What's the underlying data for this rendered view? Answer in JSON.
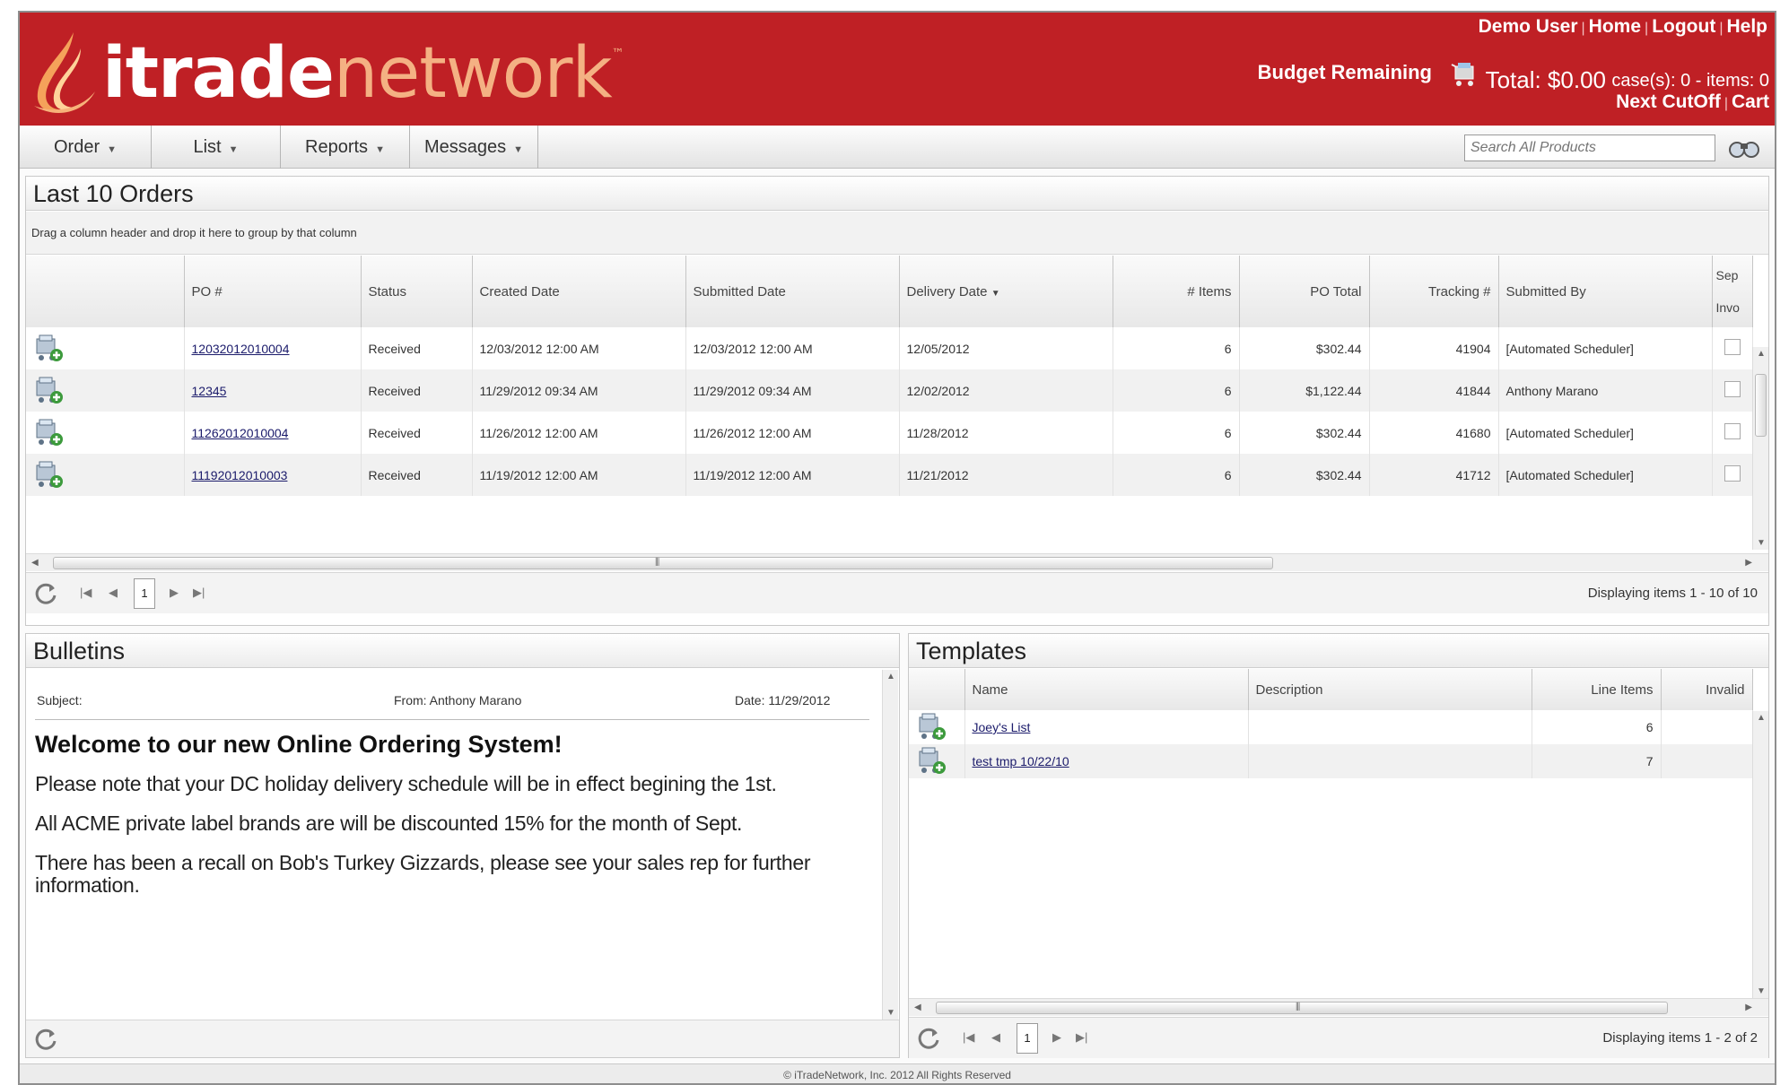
{
  "header": {
    "logo": {
      "word_main": "itrade",
      "word_accent": "network",
      "tm": "™"
    },
    "top_links": [
      "Demo User",
      "Home",
      "Logout",
      "Help"
    ],
    "budget_label": "Budget Remaining",
    "total": "Total: $0.00",
    "counts": "case(s): 0 - items: 0",
    "cart_links": [
      "Next CutOff",
      "Cart"
    ],
    "accent_color": "#bf2025"
  },
  "menu": {
    "items": [
      "Order",
      "List",
      "Reports",
      "Messages"
    ],
    "search_placeholder": "Search All Products",
    "search_icon": "binoculars-icon"
  },
  "orders": {
    "title": "Last 10 Orders",
    "group_hint": "Drag a column header and drop it here to group by that column",
    "columns": [
      "",
      "PO #",
      "Status",
      "Created Date",
      "Submitted Date",
      "Delivery Date",
      "# Items",
      "PO Total",
      "Tracking #",
      "Submitted By",
      "Sep Invo"
    ],
    "sort_indicator": "▼",
    "rows": [
      {
        "po": "12032012010004",
        "status": "Received",
        "created": "12/03/2012 12:00 AM",
        "submitted": "12/03/2012 12:00 AM",
        "delivery": "12/05/2012",
        "items": "6",
        "total": "$302.44",
        "tracking": "41904",
        "by": "[Automated Scheduler]"
      },
      {
        "po": "12345",
        "status": "Received",
        "created": "11/29/2012 09:34 AM",
        "submitted": "11/29/2012 09:34 AM",
        "delivery": "12/02/2012",
        "items": "6",
        "total": "$1,122.44",
        "tracking": "41844",
        "by": "Anthony Marano"
      },
      {
        "po": "11262012010004",
        "status": "Received",
        "created": "11/26/2012 12:00 AM",
        "submitted": "11/26/2012 12:00 AM",
        "delivery": "11/28/2012",
        "items": "6",
        "total": "$302.44",
        "tracking": "41680",
        "by": "[Automated Scheduler]"
      },
      {
        "po": "11192012010003",
        "status": "Received",
        "created": "11/19/2012 12:00 AM",
        "submitted": "11/19/2012 12:00 AM",
        "delivery": "11/21/2012",
        "items": "6",
        "total": "$302.44",
        "tracking": "41712",
        "by": "[Automated Scheduler]"
      }
    ],
    "pager": {
      "page": "1",
      "info": "Displaying items 1 - 10 of 10"
    }
  },
  "bulletins": {
    "title": "Bulletins",
    "subject_label": "Subject:",
    "from": "From: Anthony Marano",
    "date": "Date: 11/29/2012",
    "heading": "Welcome to our new Online Ordering System!",
    "paragraphs": [
      "Please note that your DC holiday delivery schedule will be in effect begining the 1st.",
      "All ACME private label brands are will be discounted 15% for the month of Sept.",
      "There has been a recall on Bob's Turkey Gizzards, please see your sales rep for further information."
    ]
  },
  "templates": {
    "title": "Templates",
    "columns": [
      "",
      "Name",
      "Description",
      "Line Items",
      "Invalid"
    ],
    "rows": [
      {
        "name": "Joey's List",
        "description": "",
        "line_items": "6",
        "invalid": ""
      },
      {
        "name": "test tmp 10/22/10",
        "description": "",
        "line_items": "7",
        "invalid": ""
      }
    ],
    "pager": {
      "page": "1",
      "info": "Displaying items 1 - 2 of 2"
    }
  },
  "footer": "© iTradeNetwork, Inc. 2012 All Rights Reserved"
}
